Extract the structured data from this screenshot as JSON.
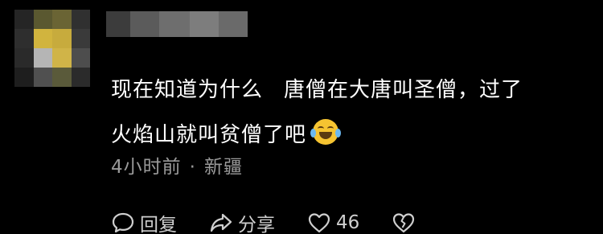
{
  "comment": {
    "line1_part1": "现在知道为什么",
    "line1_part2": "唐僧在大唐叫圣僧，过了",
    "line2": "火焰山就叫贫僧了吧",
    "emoji_icon": "laughing-crying-emoji-icon"
  },
  "meta": {
    "time": "4小时前",
    "separator": "·",
    "location": "新疆"
  },
  "actions": {
    "reply_label": "回复",
    "share_label": "分享",
    "like_count": "46"
  },
  "avatar_colors": [
    [
      "#252525",
      "#5a5830",
      "#6a6434",
      "#303030"
    ],
    [
      "#2e2e2e",
      "#d1b43e",
      "#c7ab3d",
      "#3a3a3a"
    ],
    [
      "#2a2a2a",
      "#b5b5b5",
      "#d0b448",
      "#4d4d4d"
    ],
    [
      "#1e1e1e",
      "#505050",
      "#5a5a3a",
      "#2b2b2b"
    ]
  ],
  "username_colors": [
    "#3c3c3c",
    "#5b5b5b",
    "#6e6e6e",
    "#7d7d7d",
    "#6a6a6a"
  ]
}
